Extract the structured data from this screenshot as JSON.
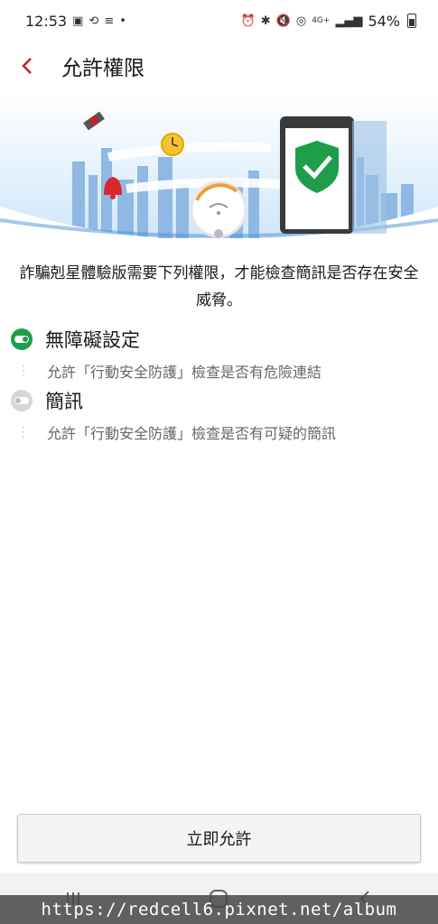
{
  "status_bar": {
    "time": "12:53",
    "network": "4G+",
    "battery": "54%"
  },
  "app_bar": {
    "title": "允許權限"
  },
  "description": "詐騙剋星體驗版需要下列權限，才能檢查簡訊是否存在安全威脅。",
  "permissions": [
    {
      "title": "無障礙設定",
      "description": "允許「行動安全防護」檢查是否有危險連結",
      "enabled": true
    },
    {
      "title": "簡訊",
      "description": "允許「行動安全防護」檢查是否有可疑的簡訊",
      "enabled": false
    }
  ],
  "allow_button": {
    "label": "立即允許"
  },
  "watermark": "https://redcell6.pixnet.net/album",
  "colors": {
    "accent": "#c2202b",
    "toggle_on": "#1e9e4a",
    "toggle_off": "#bdbdbd",
    "hero_sky": "#dceefb",
    "shield": "#1e9e4a"
  }
}
